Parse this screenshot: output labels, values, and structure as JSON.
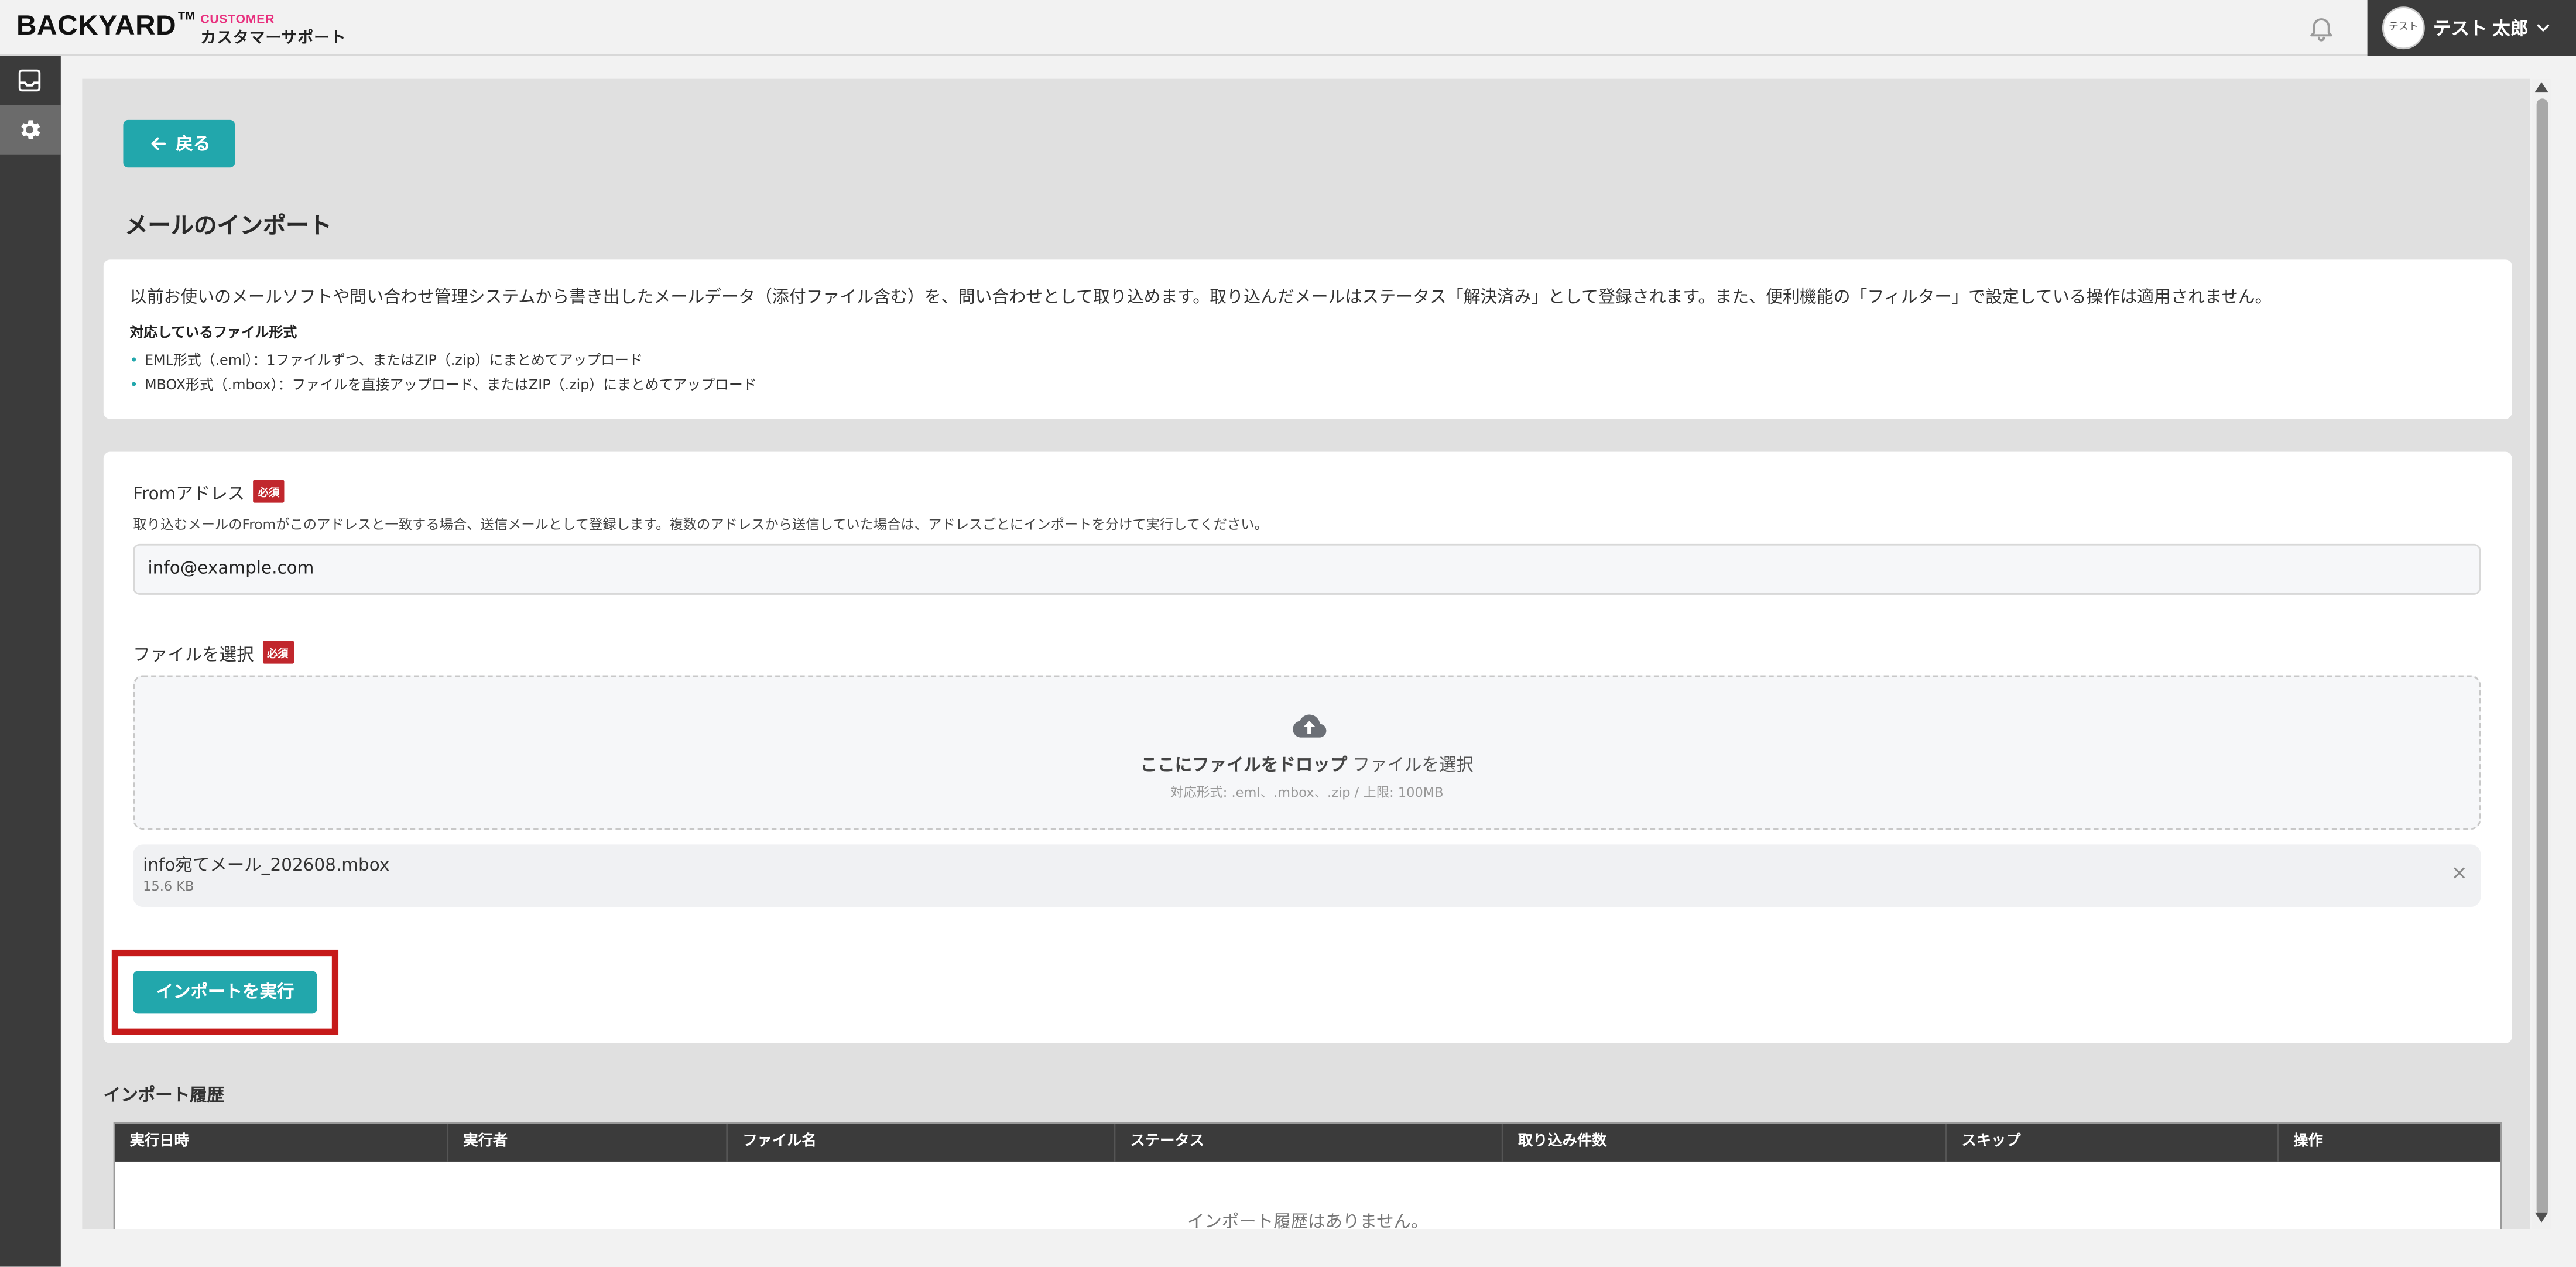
{
  "header": {
    "logo": "BACKYARD",
    "logo_tm": "TM",
    "logo_sub1": "CUSTOMER",
    "logo_sub2": "カスタマーサポート",
    "avatar_text": "テスト",
    "user_name": "テスト 太郎"
  },
  "sidebar": {
    "items": [
      {
        "icon": "inbox-icon",
        "active": false
      },
      {
        "icon": "gear-icon",
        "active": true
      }
    ]
  },
  "page": {
    "back_label": "戻る",
    "title": "メールのインポート"
  },
  "info": {
    "description": "以前お使いのメールソフトや問い合わせ管理システムから書き出したメールデータ（添付ファイル含む）を、問い合わせとして取り込めます。取り込んだメールはステータス「解決済み」として登録されます。また、便利機能の「フィルター」で設定している操作は適用されません。",
    "formats_title": "対応しているファイル形式",
    "formats": [
      "EML形式（.eml）：1ファイルずつ、またはZIP（.zip）にまとめてアップロード",
      "MBOX形式（.mbox）：ファイルを直接アップロード、またはZIP（.zip）にまとめてアップロード"
    ]
  },
  "form": {
    "from_label": "Fromアドレス",
    "required": "必須",
    "from_hint": "取り込むメールのFromがこのアドレスと一致する場合、送信メールとして登録します。複数のアドレスから送信していた場合は、アドレスごとにインポートを分けて実行してください。",
    "from_value": "info@example.com",
    "file_label": "ファイルを選択",
    "drop_main_bold": "ここにファイルをドロップ",
    "drop_main_link": "ファイルを選択",
    "drop_sub": "対応形式: .eml、.mbox、.zip / 上限: 100MB",
    "file_name": "info宛てメール_202608.mbox",
    "file_size": "15.6 KB",
    "remove": "×",
    "exec_label": "インポートを実行"
  },
  "history": {
    "title": "インポート履歴",
    "columns": [
      "実行日時",
      "実行者",
      "ファイル名",
      "ステータス",
      "取り込み件数",
      "スキップ",
      "操作"
    ],
    "empty": "インポート履歴はありません。"
  },
  "colors": {
    "accent": "#22a7ac",
    "required": "#c1272d",
    "highlight": "#c61a1a",
    "dark": "#3b3b3b"
  }
}
